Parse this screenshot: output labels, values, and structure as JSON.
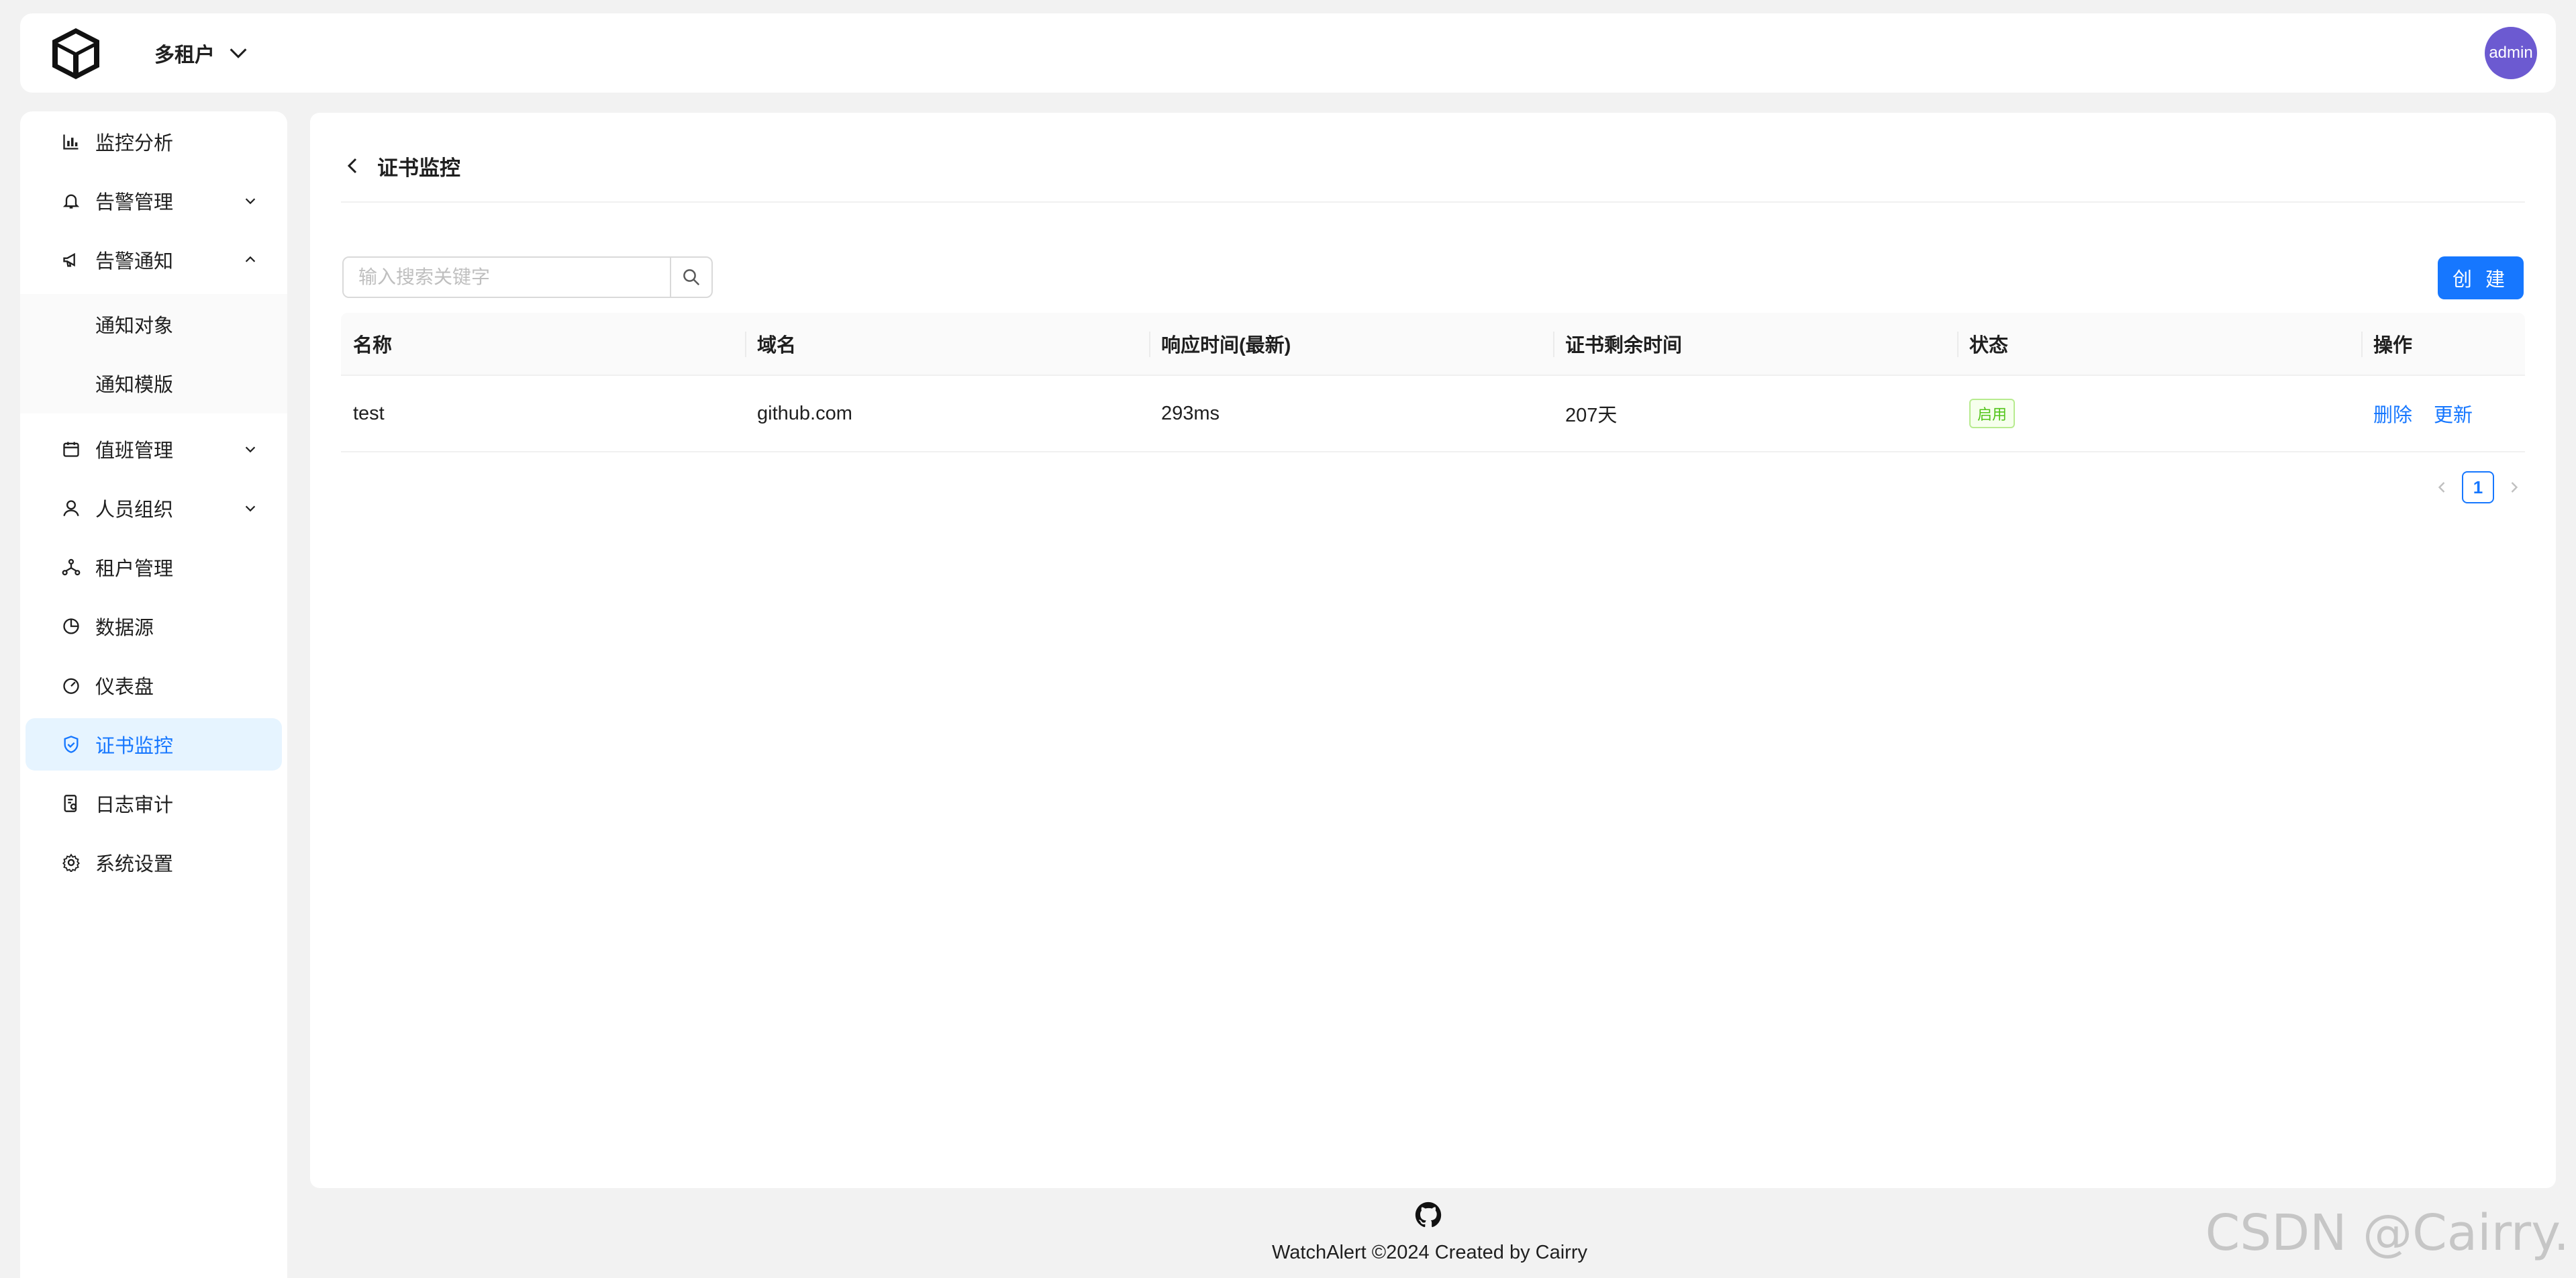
{
  "header": {
    "tenant_label": "多租户",
    "avatar_text": "admin"
  },
  "sidebar": {
    "items": [
      {
        "label": "监控分析",
        "icon": "chart-icon"
      },
      {
        "label": "告警管理",
        "icon": "bell-icon"
      },
      {
        "label": "告警通知",
        "icon": "megaphone-icon"
      },
      {
        "label": "值班管理",
        "icon": "calendar-icon"
      },
      {
        "label": "人员组织",
        "icon": "user-icon"
      },
      {
        "label": "租户管理",
        "icon": "cluster-icon"
      },
      {
        "label": "数据源",
        "icon": "pie-icon"
      },
      {
        "label": "仪表盘",
        "icon": "dashboard-icon"
      },
      {
        "label": "证书监控",
        "icon": "shield-icon"
      },
      {
        "label": "日志审计",
        "icon": "audit-icon"
      },
      {
        "label": "系统设置",
        "icon": "gear-icon"
      }
    ],
    "submenu": [
      "通知对象",
      "通知模版"
    ]
  },
  "main": {
    "title": "证书监控",
    "search_placeholder": "输入搜索关键字",
    "create_label": "创 建",
    "columns": [
      "名称",
      "域名",
      "响应时间(最新)",
      "证书剩余时间",
      "状态",
      "操作"
    ],
    "rows": [
      {
        "name": "test",
        "domain": "github.com",
        "response_time": "293ms",
        "remaining": "207天",
        "status": "启用",
        "actions": [
          "删除",
          "更新"
        ]
      }
    ],
    "page": "1"
  },
  "footer": {
    "text": "WatchAlert ©2024 Created by Cairry",
    "icon": "github-icon"
  },
  "watermark": "CSDN @Cairry.",
  "colors": {
    "accent": "#1677ff",
    "active_bg": "#e6f4ff",
    "avatar": "#6c5ad1",
    "status_green": "#52c41a"
  }
}
